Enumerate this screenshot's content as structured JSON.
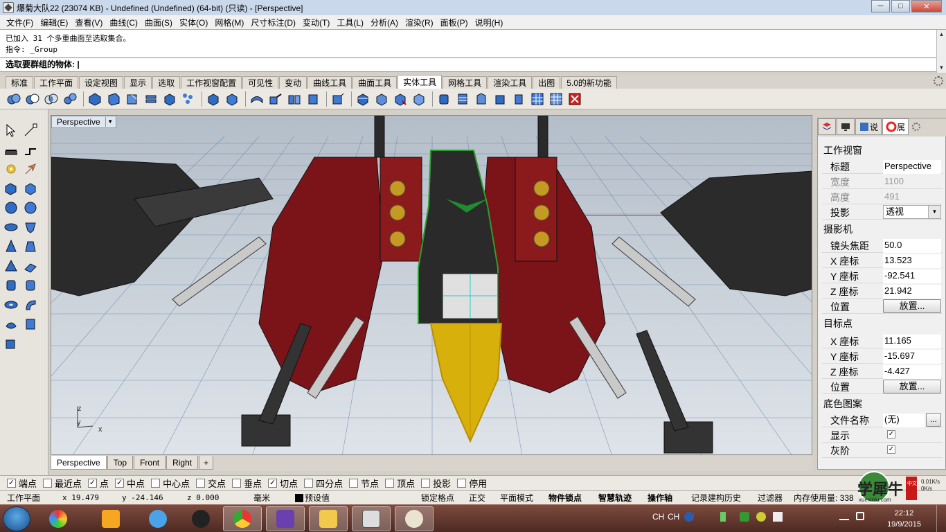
{
  "window": {
    "title": "爆菊大队22 (23074 KB) - Undefined (Undefined) (64-bit) (只读) - [Perspective]",
    "minimize": "─",
    "maximize": "□",
    "close": "✕"
  },
  "menu": [
    "文件(F)",
    "编辑(E)",
    "查看(V)",
    "曲线(C)",
    "曲面(S)",
    "实体(O)",
    "网格(M)",
    "尺寸标注(D)",
    "变动(T)",
    "工具(L)",
    "分析(A)",
    "渲染(R)",
    "面板(P)",
    "说明(H)"
  ],
  "command": {
    "history_1": "已加入 31 个多重曲面至选取集合。",
    "history_2": "指令: _Group",
    "prompt": "选取要群组的物体: |"
  },
  "toolbar_tabs": [
    "标准",
    "工作平面",
    "设定视图",
    "显示",
    "选取",
    "工作视窗配置",
    "可见性",
    "变动",
    "曲线工具",
    "曲面工具",
    "实体工具",
    "网格工具",
    "渲染工具",
    "出图",
    "5.0的新功能"
  ],
  "active_toolbar_tab": "实体工具",
  "viewport": {
    "label": "Perspective",
    "axis_z": "z",
    "axis_y": "y",
    "axis_x": "x"
  },
  "viewport_tabs": [
    "Perspective",
    "Top",
    "Front",
    "Right"
  ],
  "viewport_add": "+",
  "panel": {
    "tabs": [
      "说",
      "属"
    ],
    "section_viewport": "工作视窗",
    "title_key": "标题",
    "title_val": "Perspective",
    "width_key": "宽度",
    "width_val": "1100",
    "height_key": "高度",
    "height_val": "491",
    "proj_key": "投影",
    "proj_val": "透视",
    "section_camera": "摄影机",
    "focal_key": "镜头焦距",
    "focal_val": "50.0",
    "cam_x_key": "X 座标",
    "cam_x_val": "13.523",
    "cam_y_key": "Y 座标",
    "cam_y_val": "-92.541",
    "cam_z_key": "Z 座标",
    "cam_z_val": "21.942",
    "cam_pos_key": "位置",
    "cam_pos_btn": "放置...",
    "section_target": "目标点",
    "tgt_x_key": "X 座标",
    "tgt_x_val": "11.165",
    "tgt_y_key": "Y 座标",
    "tgt_y_val": "-15.697",
    "tgt_z_key": "Z 座标",
    "tgt_z_val": "-4.427",
    "tgt_pos_key": "位置",
    "tgt_pos_btn": "放置...",
    "section_bg": "底色图案",
    "file_key": "文件名称",
    "file_val": "(无)",
    "file_btn": "...",
    "show_key": "显示",
    "gray_key": "灰阶"
  },
  "osnap": [
    {
      "label": "端点",
      "checked": true
    },
    {
      "label": "最近点",
      "checked": false
    },
    {
      "label": "点",
      "checked": true
    },
    {
      "label": "中点",
      "checked": true
    },
    {
      "label": "中心点",
      "checked": false
    },
    {
      "label": "交点",
      "checked": false
    },
    {
      "label": "垂点",
      "checked": false
    },
    {
      "label": "切点",
      "checked": true
    },
    {
      "label": "四分点",
      "checked": false
    },
    {
      "label": "节点",
      "checked": false
    },
    {
      "label": "顶点",
      "checked": false
    },
    {
      "label": "投影",
      "checked": false
    },
    {
      "label": "停用",
      "checked": false
    }
  ],
  "status": {
    "cplane": "工作平面",
    "x": "x 19.479",
    "y": "y -24.146",
    "z": "z 0.000",
    "unit": "毫米",
    "layer": "预设值",
    "grid_snap": "锁定格点",
    "ortho": "正交",
    "planar": "平面模式",
    "osnap": "物件锁点",
    "smarttrack": "智慧轨迹",
    "gumball": "操作轴",
    "history": "记录建构历史",
    "filter": "过滤器",
    "memory": "内存使用量: 338"
  },
  "taskbar": {
    "ime": "CH",
    "ime2": "CH",
    "time": "22:12",
    "date": "19/9/2015"
  },
  "watermark": {
    "text": "学犀牛",
    "site": "xuexiniu.com",
    "badge": "中文网",
    "net_up": "0.01K/s",
    "net_down": "0K/s"
  },
  "colors": {
    "grid": "#5a7ea8",
    "body_red": "#7a1418",
    "body_dark": "#2b2b2b",
    "nose_yellow": "#d8b00c",
    "cockpit_green": "#2e9e2e"
  }
}
